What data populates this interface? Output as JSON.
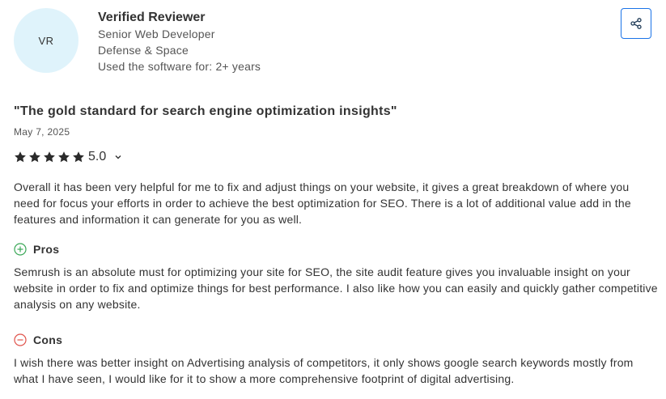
{
  "reviewer": {
    "initials": "VR",
    "name": "Verified Reviewer",
    "role": "Senior Web Developer",
    "industry": "Defense & Space",
    "usage": "Used the software for: 2+ years"
  },
  "share": {
    "icon": "share-icon"
  },
  "review": {
    "title": "\"The gold standard for search engine optimization insights\"",
    "date": "May 7, 2025",
    "rating": "5.0",
    "stars": 5,
    "body": "Overall it has been very helpful for me to fix and adjust things on your website, it gives a great breakdown of where you need for focus your efforts in order to achieve the best optimization for SEO. There is a lot of additional value add in the features and information it can generate for you as well.",
    "pros_label": "Pros",
    "pros_text": "Semrush is an absolute must for optimizing your site for SEO, the site audit feature gives you invaluable insight on your website in order to fix and optimize things for best performance. I also like how you can easily and quickly gather competitive analysis on any website.",
    "cons_label": "Cons",
    "cons_text": "I wish there was better insight on Advertising analysis of competitors, it only shows google search keywords mostly from what I have seen, I would like for it to show a more comprehensive footprint of digital advertising."
  },
  "colors": {
    "accent": "#1a73e8",
    "pros": "#3aa757",
    "cons": "#e0524a",
    "avatar_bg": "#dff3fb"
  }
}
